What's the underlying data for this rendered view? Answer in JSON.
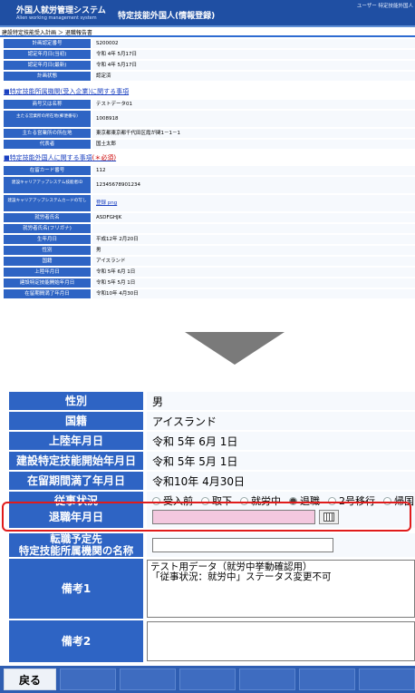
{
  "header": {
    "system_name": "外国人就労管理システム",
    "system_sub": "Alien working management system",
    "app_title": "特定技能外国人(情報登録)",
    "user_text": "ユーザー 特定技能外国人"
  },
  "breadcrumb": "建設特定技能受入計画 ＞ 退職報告書",
  "top_rows_1": [
    {
      "label": "計画認定番号",
      "value": "S200002"
    },
    {
      "label": "認定年月日(当初)",
      "value": "令和 4年 5月17日"
    },
    {
      "label": "認定年月日(最新)",
      "value": "令和 4年 5月17日"
    },
    {
      "label": "計画状態",
      "value": "認定済"
    }
  ],
  "section1_title": "■特定技能所属機関(受入企業)に関する事項",
  "top_rows_2": [
    {
      "label": "商号又は名称",
      "value": "テストデータ01"
    },
    {
      "label": "主たる営業所の所在地(郵便番号)",
      "value": "1008918"
    },
    {
      "label": "主たる営業所の所在地",
      "value": "東京都東京都千代田区霞が関1－1－1"
    },
    {
      "label": "代表者",
      "value": "国土太郎"
    }
  ],
  "section2_title": "■特定技能外国人に関する事項",
  "section2_required": "(＊必須)",
  "top_rows_3": [
    {
      "label": "在留カード番号",
      "value": "112"
    },
    {
      "label": "建設キャリアアップシステム技能者ID",
      "value": "12345678901234"
    },
    {
      "label": "建設キャリアアップシステムカードの写し",
      "value": "登録 png"
    },
    {
      "label": "就労者氏名",
      "value": "ASDFGHJK"
    },
    {
      "label": "就労者氏名(フリガナ)",
      "value": ""
    },
    {
      "label": "生年月日",
      "value": "平成12年 2月20日"
    },
    {
      "label": "性別",
      "value": "男"
    },
    {
      "label": "国籍",
      "value": "アイスランド"
    },
    {
      "label": "上陸年月日",
      "value": "令和 5年 6月 1日"
    },
    {
      "label": "建設特定技能開始年月日",
      "value": "令和 5年 5月 1日"
    },
    {
      "label": "在留期間満了年月日",
      "value": "令和10年 4月30日"
    }
  ],
  "zoom_rows": [
    {
      "label": "性別",
      "value": "男"
    },
    {
      "label": "国籍",
      "value": "アイスランド"
    },
    {
      "label": "上陸年月日",
      "value": "令和 5年 6月 1日"
    },
    {
      "label": "建設特定技能開始年月日",
      "value": "令和 5年 5月 1日"
    },
    {
      "label": "在留期間満了年月日",
      "value": "令和10年 4月30日"
    }
  ],
  "employment_status": {
    "label": "従事状況",
    "options": [
      "受入前",
      "取下",
      "就労中",
      "退職",
      "2号移行",
      "帰国"
    ],
    "selected": "退職"
  },
  "retirement_date": {
    "label": "退職年月日",
    "required_mark": "＊",
    "value": ""
  },
  "transfer_org": {
    "label_line1": "転職予定先",
    "label_line2": "特定技能所属機関の名称",
    "value": ""
  },
  "remarks1": {
    "label": "備考1",
    "value": "テスト用データ（就労中挙動確認用）\n「従事状況：就労中」ステータス変更不可"
  },
  "remarks2": {
    "label": "備考2",
    "value": ""
  },
  "footer": {
    "back_label": "戻る"
  },
  "colors": {
    "label_bg": "#2e64c4",
    "header_bg": "#1f4fa3",
    "highlight": "#e01b1b",
    "date_input_bg": "#f3c8df"
  }
}
